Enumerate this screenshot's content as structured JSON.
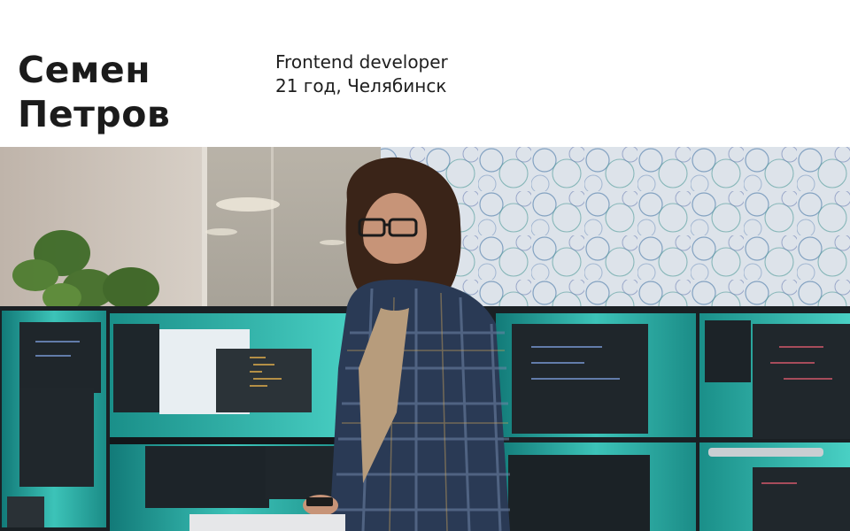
{
  "profile": {
    "first_name": "Семен",
    "last_name": "Петров",
    "role": "Frontend developer",
    "details": "21 год, Челябинск"
  },
  "photo": {
    "description_icon": "portrait-photo"
  },
  "colors": {
    "background": "#ffffff",
    "text": "#1b1b1b",
    "monitor_teal": "#2aa6a0",
    "monitor_dark": "#1c2226",
    "wall_pattern": "#dfe4ea"
  }
}
